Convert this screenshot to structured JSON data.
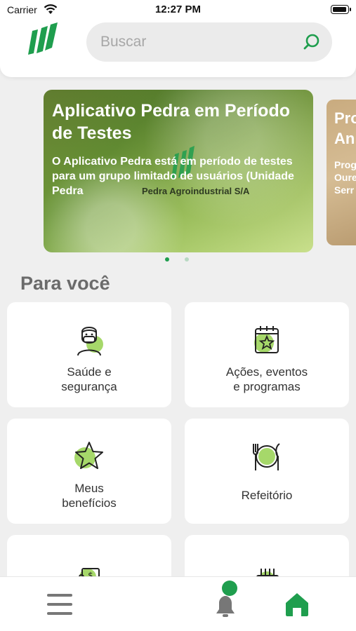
{
  "status_bar": {
    "carrier": "Carrier",
    "time": "12:27 PM"
  },
  "search": {
    "placeholder": "Buscar"
  },
  "carousel": {
    "slides": [
      {
        "title": "Aplicativo Pedra em Período de Testes",
        "text": "O Aplicativo Pedra está em período de testes para um grupo limitado de usuários (Unidade Pedra",
        "watermark": "Pedra Agroindustrial S/A"
      },
      {
        "title": "Pro\nAn",
        "text": "Prog\nOure\nSerr"
      }
    ],
    "active_index": 0
  },
  "section": {
    "title": "Para você"
  },
  "tiles": [
    {
      "label": "Saúde e\nsegurança",
      "icon": "masked-person-icon"
    },
    {
      "label": "Ações, eventos\ne programas",
      "icon": "calendar-star-icon"
    },
    {
      "label": "Meus\nbenefícios",
      "icon": "star-icon"
    },
    {
      "label": "Refeitório",
      "icon": "plate-cutlery-icon"
    },
    {
      "label": "",
      "icon": "money-hand-icon"
    },
    {
      "label": "",
      "icon": "cake-icon"
    }
  ],
  "tabbar": {
    "items": [
      "menu-icon",
      "bell-icon",
      "home-icon"
    ],
    "active": "home-icon"
  },
  "colors": {
    "brand_green": "#1f9e4e",
    "accent_light_green": "#a6d86a",
    "background": "#efefef"
  }
}
